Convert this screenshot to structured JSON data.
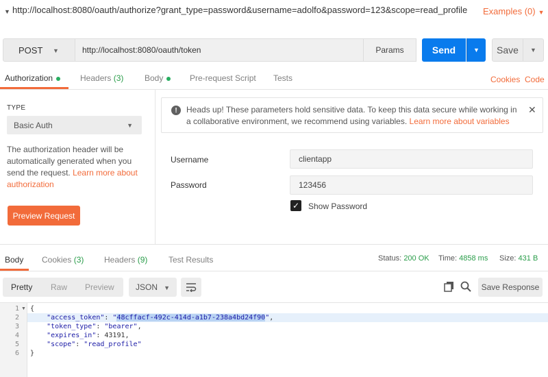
{
  "request": {
    "title": "http://localhost:8080/oauth/authorize?grant_type=password&username=adolfo&password=123&scope=read_profile",
    "examples_label": "Examples (0)",
    "method": "POST",
    "url": "http://localhost:8080/oauth/token",
    "params_label": "Params",
    "send_label": "Send",
    "save_label": "Save"
  },
  "request_tabs": [
    {
      "label": "Authorization",
      "active": true
    },
    {
      "label": "Headers",
      "count": "(3)"
    },
    {
      "label": "Body"
    },
    {
      "label": "Pre-request Script"
    },
    {
      "label": "Tests"
    }
  ],
  "request_links": {
    "cookies": "Cookies",
    "code": "Code"
  },
  "auth": {
    "type_label": "TYPE",
    "type_value": "Basic Auth",
    "desc": "The authorization header will be automatically generated when you send the request.",
    "desc_link": "Learn more about authorization",
    "preview_label": "Preview Request"
  },
  "warning": {
    "text": "Heads up! These parameters hold sensitive data. To keep this data secure while working in a collaborative environment, we recommend using variables.",
    "link": "Learn more about variables"
  },
  "fields": {
    "username_label": "Username",
    "username_value": "clientapp",
    "password_label": "Password",
    "password_value": "123456",
    "show_password_label": "Show Password"
  },
  "response_tabs": [
    {
      "label": "Body",
      "active": true
    },
    {
      "label": "Cookies",
      "count": "(3)"
    },
    {
      "label": "Headers",
      "count": "(9)"
    },
    {
      "label": "Test Results"
    }
  ],
  "response_stats": {
    "status_label": "Status:",
    "status_value": "200 OK",
    "time_label": "Time:",
    "time_value": "4858 ms",
    "size_label": "Size:",
    "size_value": "431 B"
  },
  "response_toolbar": {
    "views": [
      "Pretty",
      "Raw",
      "Preview"
    ],
    "format": "JSON",
    "save_response": "Save Response"
  },
  "response_body": {
    "line_numbers": [
      "1",
      "2",
      "3",
      "4",
      "5",
      "6"
    ],
    "access_token_key": "\"access_token\"",
    "access_token_value": "48cffacf-492c-414d-a1b7-238a4bd24f90",
    "token_type_key": "\"token_type\"",
    "token_type_value": "\"bearer\"",
    "expires_in_key": "\"expires_in\"",
    "expires_in_value": "43191",
    "scope_key": "\"scope\"",
    "scope_value": "\"read_profile\""
  },
  "colors": {
    "accent": "#f26b3a",
    "send": "#097bed",
    "success": "#2a9d4a"
  }
}
